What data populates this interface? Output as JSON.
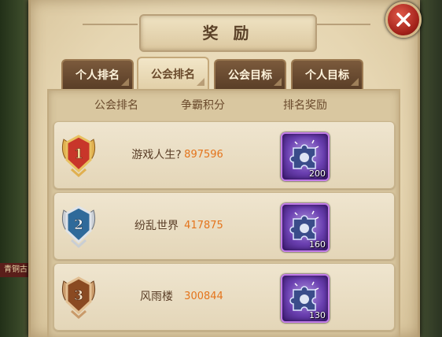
{
  "window": {
    "title": "奖 励"
  },
  "world": {
    "tag_text": "青铜古"
  },
  "tabs": [
    {
      "label": "个人排名",
      "active": false
    },
    {
      "label": "公会排名",
      "active": true
    },
    {
      "label": "公会目标",
      "active": false
    },
    {
      "label": "个人目标",
      "active": false
    }
  ],
  "table": {
    "headers": [
      "公会排名",
      "争霸积分",
      "排名奖励"
    ],
    "rows": [
      {
        "rank": "1",
        "guild": "游戏人生?",
        "score": "897596",
        "reward_icon": "puzzle-piece-icon",
        "reward_count": "200",
        "medal_color": "#c8362a"
      },
      {
        "rank": "2",
        "guild": "纷乱世界",
        "score": "417875",
        "reward_icon": "puzzle-piece-icon",
        "reward_count": "160",
        "medal_color": "#2f6a9a"
      },
      {
        "rank": "3",
        "guild": "风雨楼",
        "score": "300844",
        "reward_icon": "puzzle-piece-icon",
        "reward_count": "130",
        "medal_color": "#8a4a22"
      }
    ]
  },
  "colors": {
    "score": "#e4741c",
    "reward_border": "#c27de8",
    "accent": "#5a3e27"
  }
}
